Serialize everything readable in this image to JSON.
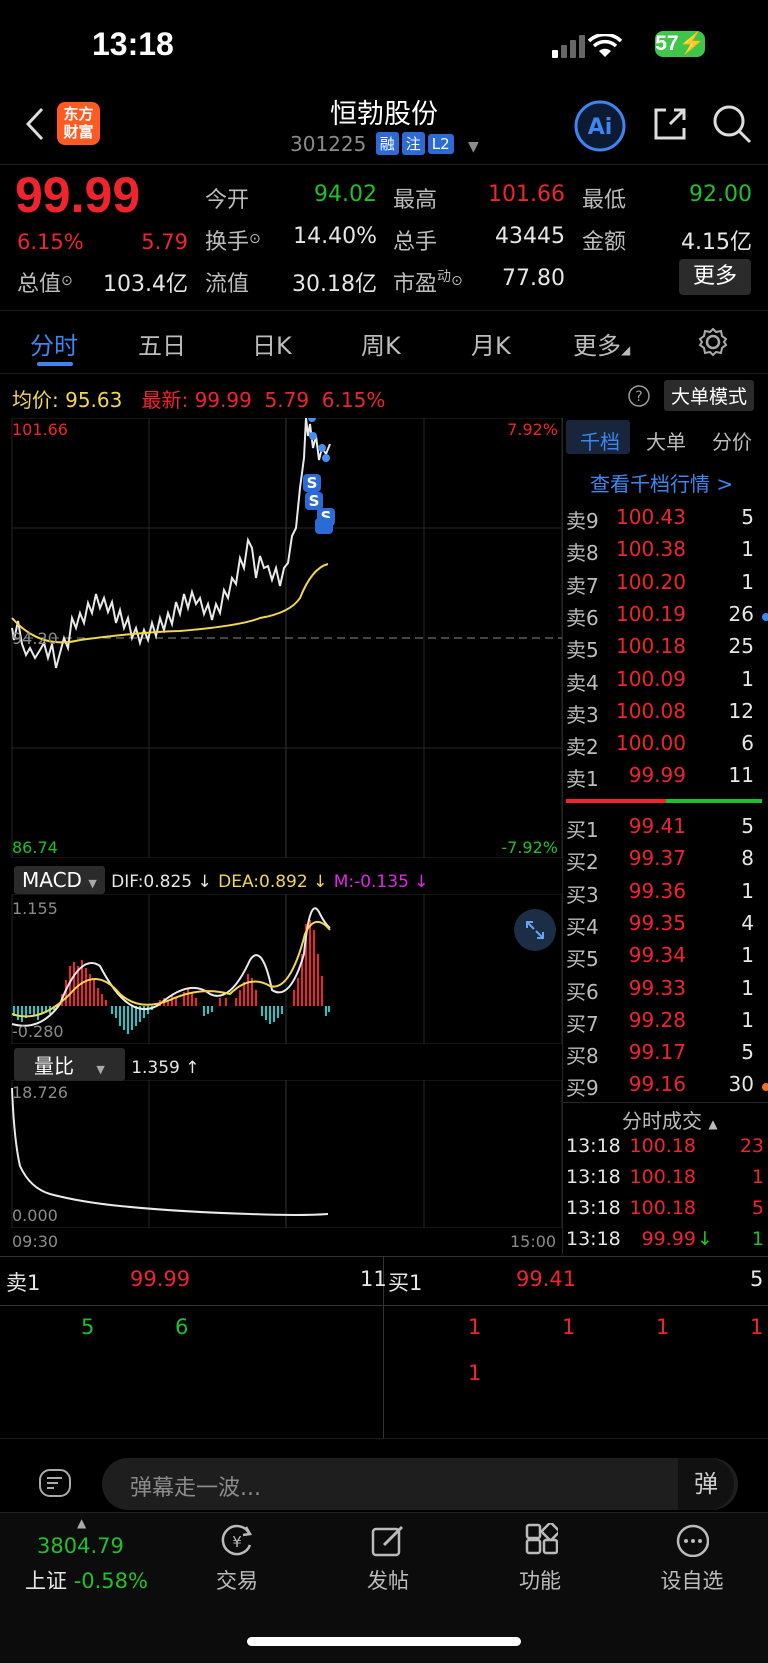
{
  "status_bar": {
    "time": "13:18",
    "battery": "57"
  },
  "header": {
    "title": "恒勃股份",
    "code": "301225",
    "tags": [
      "融",
      "注",
      "L2"
    ],
    "logo_text_1": "东方",
    "logo_text_2": "财富"
  },
  "quote": {
    "price": "99.99",
    "change_pct": "6.15%",
    "change": "5.79",
    "open_label": "今开",
    "open": "94.02",
    "high_label": "最高",
    "high": "101.66",
    "low_label": "最低",
    "low": "92.00",
    "turnover_label": "换手",
    "turnover": "14.40%",
    "volume_label": "总手",
    "volume": "43445",
    "amount_label": "金额",
    "amount": "4.15亿",
    "mktcap_label": "总值",
    "mktcap": "103.4亿",
    "float_label": "流值",
    "float": "30.18亿",
    "pe_label": "市盈",
    "pe_sup": "动",
    "pe": "77.80",
    "more_label": "更多"
  },
  "tabs": [
    "分时",
    "五日",
    "日K",
    "周K",
    "月K",
    "更多"
  ],
  "info_row": {
    "avg_label": "均价:",
    "avg": "95.63",
    "latest_label": "最新:",
    "latest": "99.99",
    "latest_chg": "5.79",
    "latest_pct": "6.15%",
    "big_order_label": "大单模式"
  },
  "chart": {
    "y_high": "101.66",
    "y_low": "86.74",
    "pct_high": "7.92%",
    "pct_low": "-7.92%",
    "prev_close": "94.20",
    "time_start": "09:30",
    "time_end": "15:00"
  },
  "macd": {
    "label": "MACD",
    "dif": "DIF:0.825 ↓",
    "dea": "DEA:0.892 ↓",
    "m": "M:-0.135 ↓",
    "y_high": "1.155",
    "y_low": "-0.280"
  },
  "volume_ratio": {
    "label": "量比",
    "value": "1.359 ↑",
    "y_high": "18.726",
    "y_low": "0.000"
  },
  "orderbook": {
    "tabs": [
      "千档",
      "大单",
      "分价"
    ],
    "link": "查看千档行情 >",
    "asks": [
      {
        "label": "卖9",
        "price": "100.43",
        "qty": "5"
      },
      {
        "label": "卖8",
        "price": "100.38",
        "qty": "1"
      },
      {
        "label": "卖7",
        "price": "100.20",
        "qty": "1"
      },
      {
        "label": "卖6",
        "price": "100.19",
        "qty": "26"
      },
      {
        "label": "卖5",
        "price": "100.18",
        "qty": "25"
      },
      {
        "label": "卖4",
        "price": "100.09",
        "qty": "1"
      },
      {
        "label": "卖3",
        "price": "100.08",
        "qty": "12"
      },
      {
        "label": "卖2",
        "price": "100.00",
        "qty": "6"
      },
      {
        "label": "卖1",
        "price": "99.99",
        "qty": "11"
      }
    ],
    "bids": [
      {
        "label": "买1",
        "price": "99.41",
        "qty": "5"
      },
      {
        "label": "买2",
        "price": "99.37",
        "qty": "8"
      },
      {
        "label": "买3",
        "price": "99.36",
        "qty": "1"
      },
      {
        "label": "买4",
        "price": "99.35",
        "qty": "4"
      },
      {
        "label": "买5",
        "price": "99.34",
        "qty": "1"
      },
      {
        "label": "买6",
        "price": "99.33",
        "qty": "1"
      },
      {
        "label": "买7",
        "price": "99.28",
        "qty": "1"
      },
      {
        "label": "买8",
        "price": "99.17",
        "qty": "5"
      },
      {
        "label": "买9",
        "price": "99.16",
        "qty": "30"
      }
    ],
    "ticks_label": "分时成交",
    "ticks": [
      {
        "time": "13:18",
        "price": "100.18",
        "vol": "23"
      },
      {
        "time": "13:18",
        "price": "100.18",
        "vol": "1"
      },
      {
        "time": "13:18",
        "price": "100.18",
        "vol": "5"
      },
      {
        "time": "13:18",
        "price": "99.99",
        "vol": "1"
      }
    ]
  },
  "level_bar": {
    "ask_label": "卖1",
    "ask_price": "99.99",
    "ask_qty": "11",
    "bid_label": "买1",
    "bid_price": "99.41",
    "bid_qty": "5",
    "ask_orders": [
      "5",
      "6"
    ],
    "bid_orders_row1": [
      "1",
      "1",
      "1",
      "1"
    ],
    "bid_orders_row2": [
      "1"
    ]
  },
  "danmu": {
    "placeholder": "弹幕走一波...",
    "icon_text": "弹"
  },
  "nav": {
    "index_value": "3804.79",
    "index_name": "上证",
    "index_change": "-0.58%",
    "items": [
      "交易",
      "发帖",
      "功能",
      "设自选"
    ]
  }
}
